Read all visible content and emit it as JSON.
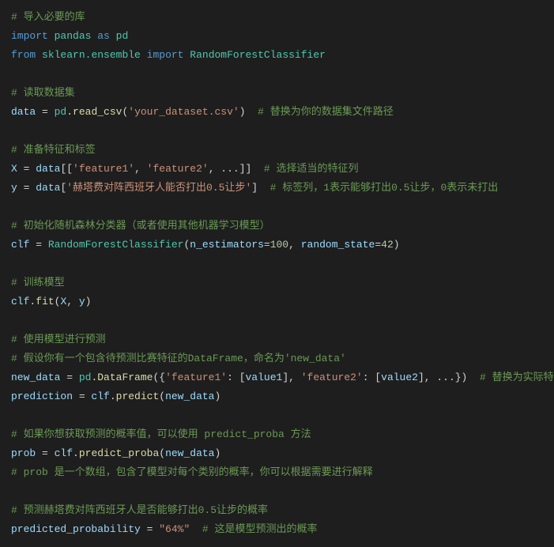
{
  "code": {
    "c1": "# 导入必要的库",
    "l2_import": "import",
    "l2_pandas": "pandas",
    "l2_as": "as",
    "l2_pd": "pd",
    "l3_from": "from",
    "l3_mod": "sklearn.ensemble",
    "l3_import": "import",
    "l3_cls": "RandomForestClassifier",
    "c2": "# 读取数据集",
    "l5_data": "data",
    "l5_eq": " = ",
    "l5_pd": "pd",
    "l5_dot": ".",
    "l5_fn": "read_csv",
    "l5_lp": "(",
    "l5_str": "'your_dataset.csv'",
    "l5_rp": ")",
    "l5_cm": "  # 替换为你的数据集文件路径",
    "c3": "# 准备特征和标签",
    "l7_X": "X",
    "l7_eq": " = ",
    "l7_data": "data",
    "l7_lb": "[[",
    "l7_f1": "'feature1'",
    "l7_comma": ", ",
    "l7_f2": "'feature2'",
    "l7_dots": ", ...]]",
    "l7_cm": "  # 选择适当的特征列",
    "l8_y": "y",
    "l8_eq": " = ",
    "l8_data": "data",
    "l8_lb": "[",
    "l8_str": "'赫塔费对阵西班牙人能否打出0.5让步'",
    "l8_rb": "]",
    "l8_cm": "  # 标签列，1表示能够打出0.5让步，0表示未打出",
    "c4": "# 初始化随机森林分类器（或者使用其他机器学习模型）",
    "l10_clf": "clf",
    "l10_eq": " = ",
    "l10_cls": "RandomForestClassifier",
    "l10_lp": "(",
    "l10_p1": "n_estimators",
    "l10_eq1": "=",
    "l10_n1": "100",
    "l10_c": ", ",
    "l10_p2": "random_state",
    "l10_eq2": "=",
    "l10_n2": "42",
    "l10_rp": ")",
    "c5": "# 训练模型",
    "l12_clf": "clf",
    "l12_dot": ".",
    "l12_fn": "fit",
    "l12_lp": "(",
    "l12_X": "X",
    "l12_c": ", ",
    "l12_y": "y",
    "l12_rp": ")",
    "c6": "# 使用模型进行预测",
    "c7": "# 假设你有一个包含待预测比赛特征的DataFrame，命名为'new_data'",
    "l15_nd": "new_data",
    "l15_eq": " = ",
    "l15_pd": "pd",
    "l15_dot": ".",
    "l15_fn": "DataFrame",
    "l15_lp": "({",
    "l15_f1": "'feature1'",
    "l15_c1": ": [",
    "l15_v1": "value1",
    "l15_rb1": "], ",
    "l15_f2": "'feature2'",
    "l15_c2": ": [",
    "l15_v2": "value2",
    "l15_rb2": "], ...})",
    "l15_cm": "  # 替换为实际特征",
    "l16_pred": "prediction",
    "l16_eq": " = ",
    "l16_clf": "clf",
    "l16_dot": ".",
    "l16_fn": "predict",
    "l16_lp": "(",
    "l16_nd": "new_data",
    "l16_rp": ")",
    "c8": "# 如果你想获取预测的概率值，可以使用 predict_proba 方法",
    "l18_prob": "prob",
    "l18_eq": " = ",
    "l18_clf": "clf",
    "l18_dot": ".",
    "l18_fn": "predict_proba",
    "l18_lp": "(",
    "l18_nd": "new_data",
    "l18_rp": ")",
    "c9": "# prob 是一个数组，包含了模型对每个类别的概率，你可以根据需要进行解释",
    "c10": "# 预测赫塔费对阵西班牙人是否能够打出0.5让步的概率",
    "l20_pp": "predicted_probability",
    "l20_eq": " = ",
    "l20_str": "\"64%\"",
    "l20_cm": "  # 这是模型预测出的概率"
  }
}
